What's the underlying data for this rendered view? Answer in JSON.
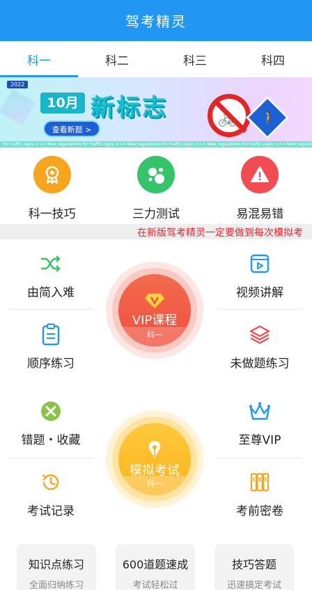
{
  "header": {
    "title": "驾考精灵"
  },
  "tabs": [
    {
      "label": "科一",
      "active": true
    },
    {
      "label": "科二",
      "active": false
    },
    {
      "label": "科三",
      "active": false
    },
    {
      "label": "科四",
      "active": false
    }
  ],
  "banner": {
    "year_tag": "2022",
    "month": "10月",
    "headline": "新标志",
    "button": "查看新题 >",
    "strip_text": "for traffic signs  >>>  New regulations for traffic signs  >>>  New regulations for traffic signs  >>>  New regulations for traffic signs  >>>  New regulations for traffic signs  >>>  New regulations for traffic signs"
  },
  "tools": [
    {
      "label": "科一技巧",
      "icon": "medal-icon",
      "color": "#f7a51f"
    },
    {
      "label": "三力测试",
      "icon": "bubbles-icon",
      "color": "#35c46a"
    },
    {
      "label": "易混易错",
      "icon": "warning-icon",
      "color": "#f04c52"
    }
  ],
  "marquee": {
    "text": "在新版驾考精灵一定要做到每次模拟考"
  },
  "section1": {
    "top_left": "由简入难",
    "top_right": "视频讲解",
    "bottom_left": "顺序练习",
    "bottom_right": "未做题练习",
    "center_label": "VIP课程",
    "center_sub": "科一"
  },
  "section2": {
    "top_left": "错题・收藏",
    "top_right": "至尊VIP",
    "bottom_left": "考试记录",
    "bottom_right": "考前密卷",
    "center_label": "模拟考试",
    "center_sub": "科一"
  },
  "cards": [
    {
      "title": "知识点练习",
      "sub": "全面归纳练习"
    },
    {
      "title": "600道题速成",
      "sub": "考试轻松过"
    },
    {
      "title": "技巧答题",
      "sub": "迅速搞定考试"
    }
  ],
  "colors": {
    "primary": "#2196f3",
    "green": "#35c46a",
    "orange": "#f7a51f",
    "red": "#f04c52"
  }
}
